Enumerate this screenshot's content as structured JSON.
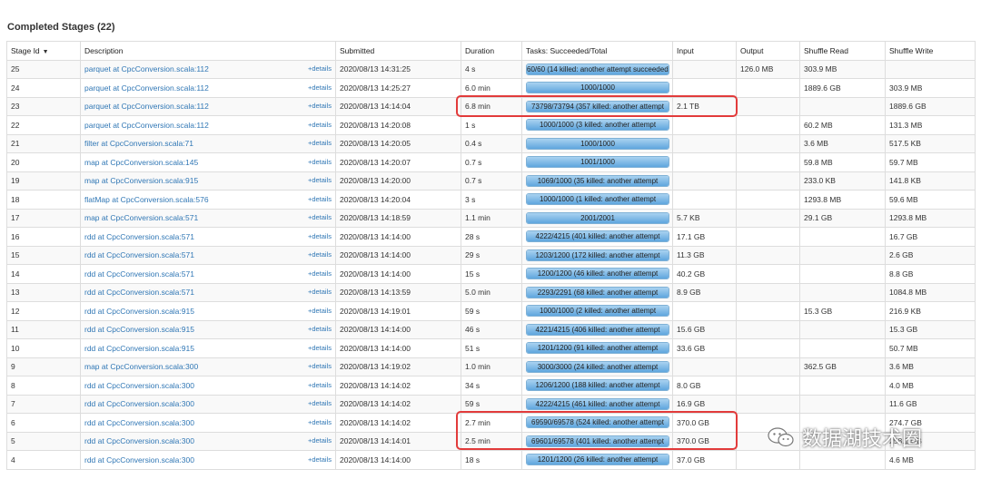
{
  "page": {
    "title": "Completed Stages (22)"
  },
  "table": {
    "columns": [
      "Stage Id",
      "Description",
      "Submitted",
      "Duration",
      "Tasks: Succeeded/Total",
      "Input",
      "Output",
      "Shuffle Read",
      "Shuffle Write"
    ],
    "details_label": "+details",
    "rows": [
      {
        "id": "25",
        "desc": "parquet at CpcConversion.scala:112",
        "submitted": "2020/08/13 14:31:25",
        "duration": "4 s",
        "tasks": "60/60 (14 killed: another attempt succeeded)",
        "progress": 1.0,
        "input": "",
        "output": "126.0 MB",
        "shuffle_read": "303.9 MB",
        "shuffle_write": ""
      },
      {
        "id": "24",
        "desc": "parquet at CpcConversion.scala:112",
        "submitted": "2020/08/13 14:25:27",
        "duration": "6.0 min",
        "tasks": "1000/1000",
        "progress": 1.0,
        "input": "",
        "output": "",
        "shuffle_read": "1889.6 GB",
        "shuffle_write": "303.9 MB"
      },
      {
        "id": "23",
        "desc": "parquet at CpcConversion.scala:112",
        "submitted": "2020/08/13 14:14:04",
        "duration": "6.8 min",
        "tasks": "73798/73794 (357 killed: another attempt",
        "progress": 1.0,
        "input": "2.1 TB",
        "output": "",
        "shuffle_read": "",
        "shuffle_write": "1889.6 GB"
      },
      {
        "id": "22",
        "desc": "parquet at CpcConversion.scala:112",
        "submitted": "2020/08/13 14:20:08",
        "duration": "1 s",
        "tasks": "1000/1000 (3 killed: another attempt",
        "progress": 1.0,
        "input": "",
        "output": "",
        "shuffle_read": "60.2 MB",
        "shuffle_write": "131.3 MB"
      },
      {
        "id": "21",
        "desc": "filter at CpcConversion.scala:71",
        "submitted": "2020/08/13 14:20:05",
        "duration": "0.4 s",
        "tasks": "1000/1000",
        "progress": 1.0,
        "input": "",
        "output": "",
        "shuffle_read": "3.6 MB",
        "shuffle_write": "517.5 KB"
      },
      {
        "id": "20",
        "desc": "map at CpcConversion.scala:145",
        "submitted": "2020/08/13 14:20:07",
        "duration": "0.7 s",
        "tasks": "1001/1000",
        "progress": 1.0,
        "input": "",
        "output": "",
        "shuffle_read": "59.8 MB",
        "shuffle_write": "59.7 MB"
      },
      {
        "id": "19",
        "desc": "map at CpcConversion.scala:915",
        "submitted": "2020/08/13 14:20:00",
        "duration": "0.7 s",
        "tasks": "1069/1000 (35 killed: another attempt",
        "progress": 1.0,
        "input": "",
        "output": "",
        "shuffle_read": "233.0 KB",
        "shuffle_write": "141.8 KB"
      },
      {
        "id": "18",
        "desc": "flatMap at CpcConversion.scala:576",
        "submitted": "2020/08/13 14:20:04",
        "duration": "3 s",
        "tasks": "1000/1000 (1 killed: another attempt",
        "progress": 1.0,
        "input": "",
        "output": "",
        "shuffle_read": "1293.8 MB",
        "shuffle_write": "59.6 MB"
      },
      {
        "id": "17",
        "desc": "map at CpcConversion.scala:571",
        "submitted": "2020/08/13 14:18:59",
        "duration": "1.1 min",
        "tasks": "2001/2001",
        "progress": 1.0,
        "input": "5.7 KB",
        "output": "",
        "shuffle_read": "29.1 GB",
        "shuffle_write": "1293.8 MB"
      },
      {
        "id": "16",
        "desc": "rdd at CpcConversion.scala:571",
        "submitted": "2020/08/13 14:14:00",
        "duration": "28 s",
        "tasks": "4222/4215 (401 killed: another attempt",
        "progress": 1.0,
        "input": "17.1 GB",
        "output": "",
        "shuffle_read": "",
        "shuffle_write": "16.7 GB"
      },
      {
        "id": "15",
        "desc": "rdd at CpcConversion.scala:571",
        "submitted": "2020/08/13 14:14:00",
        "duration": "29 s",
        "tasks": "1203/1200 (172 killed: another attempt",
        "progress": 1.0,
        "input": "11.3 GB",
        "output": "",
        "shuffle_read": "",
        "shuffle_write": "2.6 GB"
      },
      {
        "id": "14",
        "desc": "rdd at CpcConversion.scala:571",
        "submitted": "2020/08/13 14:14:00",
        "duration": "15 s",
        "tasks": "1200/1200 (46 killed: another attempt",
        "progress": 1.0,
        "input": "40.2 GB",
        "output": "",
        "shuffle_read": "",
        "shuffle_write": "8.8 GB"
      },
      {
        "id": "13",
        "desc": "rdd at CpcConversion.scala:571",
        "submitted": "2020/08/13 14:13:59",
        "duration": "5.0 min",
        "tasks": "2293/2291 (68 killed: another attempt",
        "progress": 1.0,
        "input": "8.9 GB",
        "output": "",
        "shuffle_read": "",
        "shuffle_write": "1084.8 MB"
      },
      {
        "id": "12",
        "desc": "rdd at CpcConversion.scala:915",
        "submitted": "2020/08/13 14:19:01",
        "duration": "59 s",
        "tasks": "1000/1000 (2 killed: another attempt",
        "progress": 1.0,
        "input": "",
        "output": "",
        "shuffle_read": "15.3 GB",
        "shuffle_write": "216.9 KB"
      },
      {
        "id": "11",
        "desc": "rdd at CpcConversion.scala:915",
        "submitted": "2020/08/13 14:14:00",
        "duration": "46 s",
        "tasks": "4221/4215 (406 killed: another attempt",
        "progress": 1.0,
        "input": "15.6 GB",
        "output": "",
        "shuffle_read": "",
        "shuffle_write": "15.3 GB"
      },
      {
        "id": "10",
        "desc": "rdd at CpcConversion.scala:915",
        "submitted": "2020/08/13 14:14:00",
        "duration": "51 s",
        "tasks": "1201/1200 (91 killed: another attempt",
        "progress": 1.0,
        "input": "33.6 GB",
        "output": "",
        "shuffle_read": "",
        "shuffle_write": "50.7 MB"
      },
      {
        "id": "9",
        "desc": "map at CpcConversion.scala:300",
        "submitted": "2020/08/13 14:19:02",
        "duration": "1.0 min",
        "tasks": "3000/3000 (24 killed: another attempt",
        "progress": 1.0,
        "input": "",
        "output": "",
        "shuffle_read": "362.5 GB",
        "shuffle_write": "3.6 MB"
      },
      {
        "id": "8",
        "desc": "rdd at CpcConversion.scala:300",
        "submitted": "2020/08/13 14:14:02",
        "duration": "34 s",
        "tasks": "1206/1200 (188 killed: another attempt",
        "progress": 1.0,
        "input": "8.0 GB",
        "output": "",
        "shuffle_read": "",
        "shuffle_write": "4.0 MB"
      },
      {
        "id": "7",
        "desc": "rdd at CpcConversion.scala:300",
        "submitted": "2020/08/13 14:14:02",
        "duration": "59 s",
        "tasks": "4222/4215 (461 killed: another attempt",
        "progress": 1.0,
        "input": "16.9 GB",
        "output": "",
        "shuffle_read": "",
        "shuffle_write": "11.6 GB"
      },
      {
        "id": "6",
        "desc": "rdd at CpcConversion.scala:300",
        "submitted": "2020/08/13 14:14:02",
        "duration": "2.7 min",
        "tasks": "69590/69578 (524 killed: another attempt",
        "progress": 1.0,
        "input": "370.0 GB",
        "output": "",
        "shuffle_read": "",
        "shuffle_write": "274.7 GB"
      },
      {
        "id": "5",
        "desc": "rdd at CpcConversion.scala:300",
        "submitted": "2020/08/13 14:14:01",
        "duration": "2.5 min",
        "tasks": "69601/69578 (401 killed: another attempt",
        "progress": 1.0,
        "input": "370.0 GB",
        "output": "",
        "shuffle_read": "",
        "shuffle_write": "258.1 GB"
      },
      {
        "id": "4",
        "desc": "rdd at CpcConversion.scala:300",
        "submitted": "2020/08/13 14:14:00",
        "duration": "18 s",
        "tasks": "1201/1200 (26 killed: another attempt",
        "progress": 1.0,
        "input": "37.0 GB",
        "output": "",
        "shuffle_read": "",
        "shuffle_write": "4.6 MB"
      }
    ]
  },
  "colors": {
    "highlight": "#e23b3b",
    "link": "#3077b5",
    "bar": "#5fa6de"
  },
  "watermark": {
    "text": "数据湖技术圈",
    "icon": "wechat-icon"
  }
}
